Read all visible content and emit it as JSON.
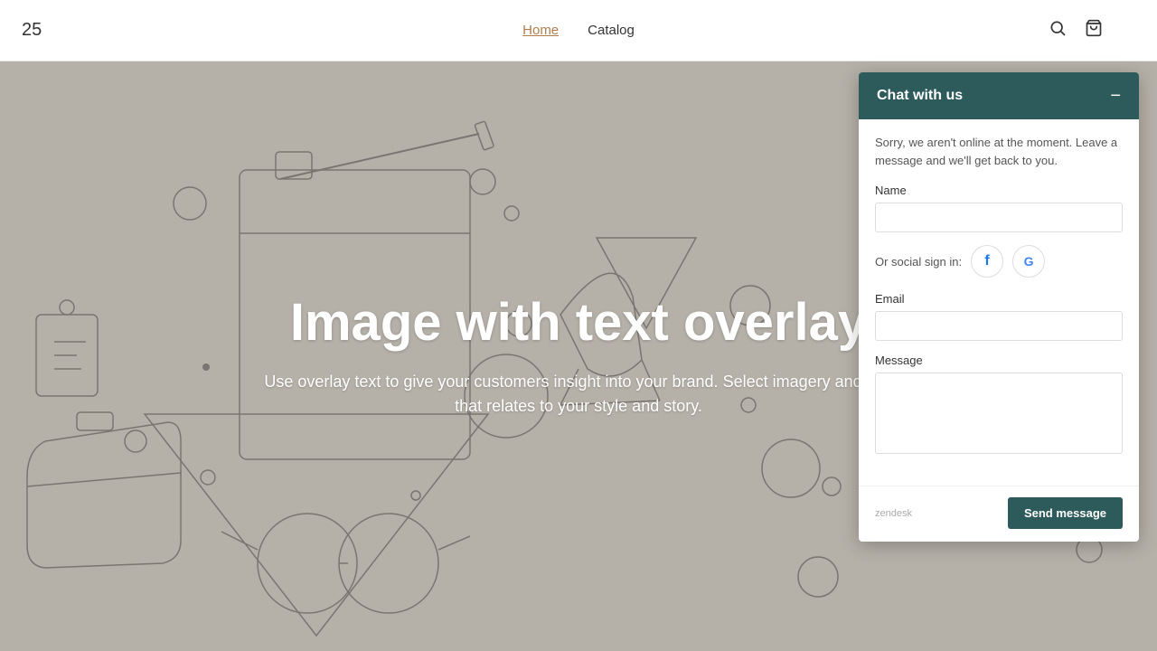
{
  "nav": {
    "brand": "25",
    "links": [
      {
        "label": "Home",
        "active": true
      },
      {
        "label": "Catalog",
        "active": false
      }
    ],
    "search_icon": "search",
    "cart_icon": "shopping-bag"
  },
  "hero": {
    "title": "Image with text overlay",
    "subtitle": "Use overlay text to give your customers insight into your brand. Select imagery and text that relates to your style and story."
  },
  "chat": {
    "header_title": "Chat with us",
    "minimize_label": "−",
    "offline_message": "Sorry, we aren't online at the moment. Leave a message and we'll get back to you.",
    "name_label": "Name",
    "name_placeholder": "",
    "social_label": "Or social sign in:",
    "email_label": "Email",
    "email_placeholder": "",
    "message_label": "Message",
    "message_placeholder": "",
    "send_button_label": "Send message",
    "powered_by": "zendesk"
  }
}
